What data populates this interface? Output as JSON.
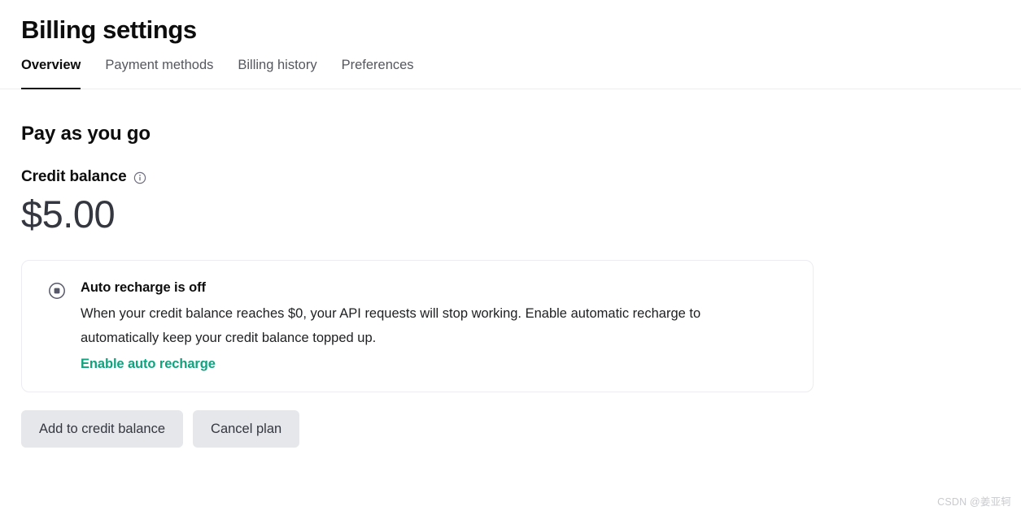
{
  "header": {
    "title": "Billing settings",
    "tabs": [
      {
        "label": "Overview",
        "active": true
      },
      {
        "label": "Payment methods",
        "active": false
      },
      {
        "label": "Billing history",
        "active": false
      },
      {
        "label": "Preferences",
        "active": false
      }
    ]
  },
  "main": {
    "section_title": "Pay as you go",
    "balance": {
      "label": "Credit balance",
      "info_icon": "info-circle-icon",
      "amount": "$5.00"
    },
    "auto_recharge_card": {
      "status_icon": "stop-circle-icon",
      "title": "Auto recharge is off",
      "description": "When your credit balance reaches $0, your API requests will stop working. Enable automatic recharge to automatically keep your credit balance topped up.",
      "link_label": "Enable auto recharge"
    },
    "actions": [
      {
        "label": "Add to credit balance"
      },
      {
        "label": "Cancel plan"
      }
    ]
  },
  "colors": {
    "accent_green": "#10a37f",
    "text_primary": "#0d0d0d",
    "text_secondary": "#55575f",
    "button_bg": "#e6e7ea",
    "border": "#ececf1"
  },
  "watermark": {
    "text": "CSDN @姜亚轲"
  }
}
